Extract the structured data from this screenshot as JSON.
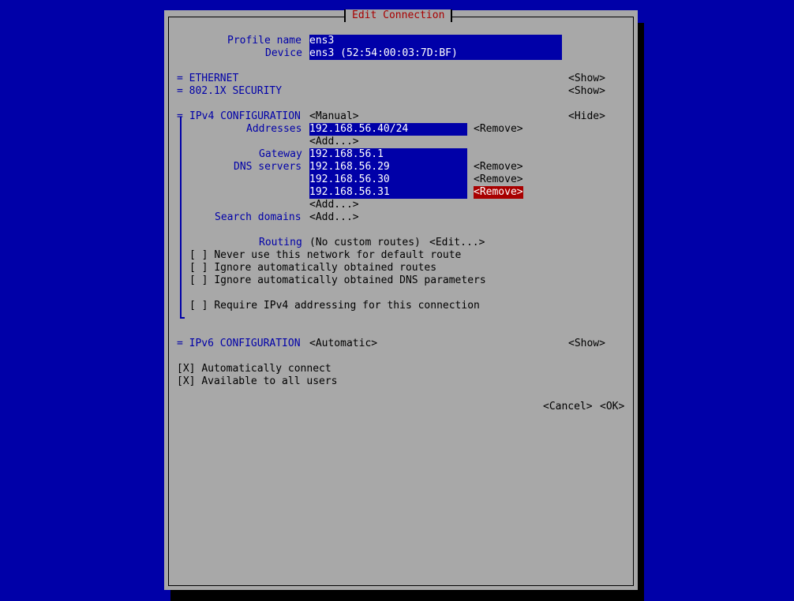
{
  "dialog": {
    "title": "Edit Connection"
  },
  "profile": {
    "label": "Profile name",
    "value": "ens3"
  },
  "device": {
    "label": "Device",
    "value": "ens3 (52:54:00:03:7D:BF)"
  },
  "ethernet": {
    "label": "= ETHERNET",
    "toggle": "<Show>"
  },
  "security": {
    "label": "= 802.1X SECURITY",
    "toggle": "<Show>"
  },
  "ipv4": {
    "label": "IPv4 CONFIGURATION",
    "marker": "=",
    "mode": "<Manual>",
    "toggle": "<Hide>",
    "addresses_label": "Addresses",
    "addresses": [
      "192.168.56.40/24"
    ],
    "gateway_label": "Gateway",
    "gateway": "192.168.56.1",
    "dns_label": "DNS servers",
    "dns": [
      "192.168.56.29",
      "192.168.56.30",
      "192.168.56.31"
    ],
    "search_label": "Search domains",
    "routing_label": "Routing",
    "routing_value": "(No custom routes)",
    "routing_edit": "<Edit...>",
    "remove": "<Remove>",
    "add": "<Add...>",
    "checks": [
      {
        "box": "[ ]",
        "text": "Never use this network for default route"
      },
      {
        "box": "[ ]",
        "text": "Ignore automatically obtained routes"
      },
      {
        "box": "[ ]",
        "text": "Ignore automatically obtained DNS parameters"
      }
    ],
    "require": {
      "box": "[ ]",
      "text": "Require IPv4 addressing for this connection"
    }
  },
  "ipv6": {
    "label": "= IPv6 CONFIGURATION",
    "mode": "<Automatic>",
    "toggle": "<Show>"
  },
  "auto_connect": {
    "box": "[X]",
    "text": "Automatically connect"
  },
  "all_users": {
    "box": "[X]",
    "text": "Available to all users"
  },
  "buttons": {
    "cancel": "<Cancel>",
    "ok": "<OK>"
  }
}
